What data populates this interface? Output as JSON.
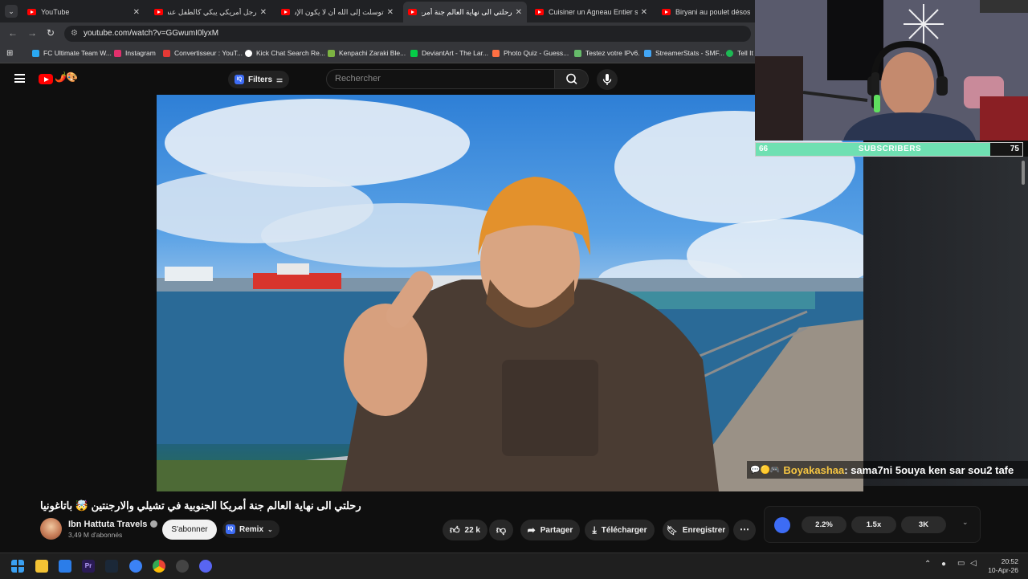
{
  "browser": {
    "tabs": [
      {
        "title": "YouTube",
        "active": false
      },
      {
        "title": "رجل أمريكي يبكي كالطفل عندما...",
        "active": false
      },
      {
        "title": "توسلت إلى الله أن لا يكون الإسلا\"",
        "active": false
      },
      {
        "title": "رحلتي الى نهاية العالم جنة أمريكا",
        "active": true
      },
      {
        "title": "Cuisiner un Agneau Entier sous...",
        "active": false
      },
      {
        "title": "Biryani au poulet désossé sp...",
        "active": false
      }
    ],
    "url": "youtube.com/watch?v=GGwumI0lyxM",
    "bookmarks": [
      {
        "label": "FC Ultimate Team W...",
        "color": "#2aa8f2"
      },
      {
        "label": "Instagram",
        "color": "#e1306c"
      },
      {
        "label": "Convertisseur : YouT...",
        "color": "#e53935"
      },
      {
        "label": "Kick Chat Search Re...",
        "color": "#ffffff"
      },
      {
        "label": "Kenpachi Zaraki Ble...",
        "color": "#7cb342"
      },
      {
        "label": "DeviantArt - The Lar...",
        "color": "#05cc47"
      },
      {
        "label": "Photo Quiz - Guess...",
        "color": "#ff7043"
      },
      {
        "label": "Testez votre IPv6.",
        "color": "#66bb6a"
      },
      {
        "label": "StreamerStats - SMF...",
        "color": "#42a5f5"
      },
      {
        "label": "Tell It",
        "color": "#1db954"
      }
    ]
  },
  "youtube": {
    "filters_label": "Filters",
    "search_placeholder": "Rechercher",
    "video_title": "رحلتي الى نهاية العالم جنة أمريكا الجنوبية في تشيلي والارجنتين 🤯 باتاغونيا",
    "channel_name": "Ibn Hattuta Travels",
    "subscribers": "3,49 M d'abonnés",
    "subscribe_label": "S'abonner",
    "remix_label": "Remix",
    "likes": "22 k",
    "share_label": "Partager",
    "download_label": "Télécharger",
    "save_label": "Enregistrer"
  },
  "speed_control": {
    "options": [
      "2.2%",
      "1.5x",
      "3K"
    ]
  },
  "stream_overlay": {
    "subscriber_current": "66",
    "subscriber_label": "SUBSCRIBERS",
    "subscriber_goal": "75",
    "progress_fraction": 0.88,
    "chat_user": "Boyakashaa",
    "chat_message": ": sama7ni 5ouya ken sar sou2 tafe"
  },
  "taskbar": {
    "time": "20:52",
    "date": "10-Apr-26"
  },
  "colors": {
    "youtube_red": "#ff0000",
    "progress_green": "#6fe0b2",
    "chat_user": "#f5c542"
  }
}
